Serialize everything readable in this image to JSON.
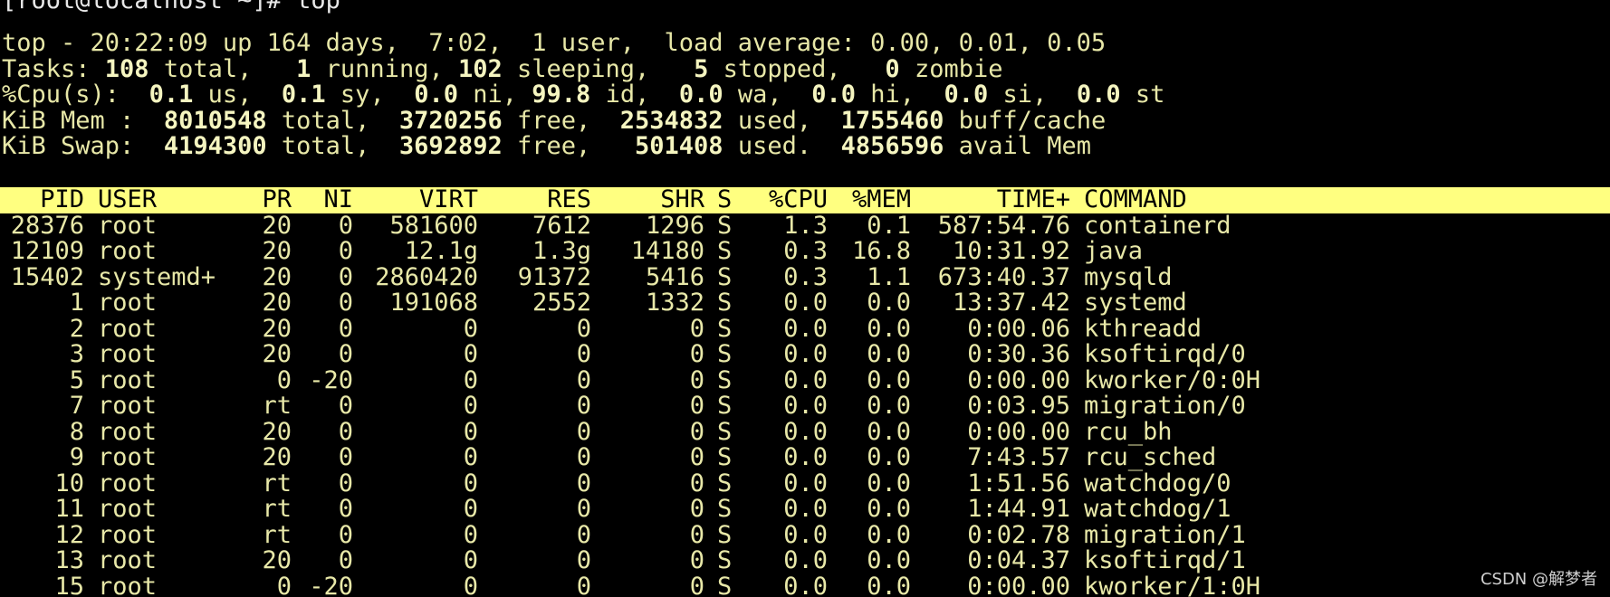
{
  "terminal": {
    "prompt": "[root@localhost ~]# ",
    "command": "top",
    "summary": {
      "top_line": "top - 20:22:09 up 164 days,  7:02,  1 user,  load average: 0.00, 0.01, 0.05",
      "tasks": {
        "label": "Tasks: ",
        "total": "108",
        "total_label": " total,   ",
        "running": "1",
        "running_label": " running, ",
        "sleeping": "102",
        "sleeping_label": " sleeping,   ",
        "stopped": "5",
        "stopped_label": " stopped,   ",
        "zombie": "0",
        "zombie_label": " zombie"
      },
      "cpu": {
        "label": "%Cpu(s):  ",
        "us": "0.1",
        "us_label": " us,  ",
        "sy": "0.1",
        "sy_label": " sy,  ",
        "ni": "0.0",
        "ni_label": " ni, ",
        "id": "99.8",
        "id_label": " id,  ",
        "wa": "0.0",
        "wa_label": " wa,  ",
        "hi": "0.0",
        "hi_label": " hi,  ",
        "si": "0.0",
        "si_label": " si,  ",
        "st": "0.0",
        "st_label": " st"
      },
      "mem": {
        "label": "KiB Mem :  ",
        "total": "8010548",
        "total_label": " total,  ",
        "free": "3720256",
        "free_label": " free,  ",
        "used": "2534832",
        "used_label": " used,  ",
        "cache": "1755460",
        "cache_label": " buff/cache"
      },
      "swap": {
        "label": "KiB Swap:  ",
        "total": "4194300",
        "total_label": " total,  ",
        "free": "3692892",
        "free_label": " free,   ",
        "used": "501408",
        "used_label": " used.  ",
        "avail": "4856596",
        "avail_label": " avail Mem"
      }
    },
    "columns": {
      "pid": "PID",
      "user": "USER",
      "pr": "PR",
      "ni": "NI",
      "virt": "VIRT",
      "res": "RES",
      "shr": "SHR",
      "s": "S",
      "cpu": "%CPU",
      "mem": "%MEM",
      "time": "TIME+",
      "command": "COMMAND"
    },
    "processes": [
      {
        "pid": "28376",
        "user": "root",
        "pr": "20",
        "ni": "0",
        "virt": "581600",
        "res": "7612",
        "shr": "1296",
        "s": "S",
        "cpu": "1.3",
        "mem": "0.1",
        "time": "587:54.76",
        "command": "containerd"
      },
      {
        "pid": "12109",
        "user": "root",
        "pr": "20",
        "ni": "0",
        "virt": "12.1g",
        "res": "1.3g",
        "shr": "14180",
        "s": "S",
        "cpu": "0.3",
        "mem": "16.8",
        "time": "10:31.92",
        "command": "java"
      },
      {
        "pid": "15402",
        "user": "systemd+",
        "pr": "20",
        "ni": "0",
        "virt": "2860420",
        "res": "91372",
        "shr": "5416",
        "s": "S",
        "cpu": "0.3",
        "mem": "1.1",
        "time": "673:40.37",
        "command": "mysqld"
      },
      {
        "pid": "1",
        "user": "root",
        "pr": "20",
        "ni": "0",
        "virt": "191068",
        "res": "2552",
        "shr": "1332",
        "s": "S",
        "cpu": "0.0",
        "mem": "0.0",
        "time": "13:37.42",
        "command": "systemd"
      },
      {
        "pid": "2",
        "user": "root",
        "pr": "20",
        "ni": "0",
        "virt": "0",
        "res": "0",
        "shr": "0",
        "s": "S",
        "cpu": "0.0",
        "mem": "0.0",
        "time": "0:00.06",
        "command": "kthreadd"
      },
      {
        "pid": "3",
        "user": "root",
        "pr": "20",
        "ni": "0",
        "virt": "0",
        "res": "0",
        "shr": "0",
        "s": "S",
        "cpu": "0.0",
        "mem": "0.0",
        "time": "0:30.36",
        "command": "ksoftirqd/0"
      },
      {
        "pid": "5",
        "user": "root",
        "pr": "0",
        "ni": "-20",
        "virt": "0",
        "res": "0",
        "shr": "0",
        "s": "S",
        "cpu": "0.0",
        "mem": "0.0",
        "time": "0:00.00",
        "command": "kworker/0:0H"
      },
      {
        "pid": "7",
        "user": "root",
        "pr": "rt",
        "ni": "0",
        "virt": "0",
        "res": "0",
        "shr": "0",
        "s": "S",
        "cpu": "0.0",
        "mem": "0.0",
        "time": "0:03.95",
        "command": "migration/0"
      },
      {
        "pid": "8",
        "user": "root",
        "pr": "20",
        "ni": "0",
        "virt": "0",
        "res": "0",
        "shr": "0",
        "s": "S",
        "cpu": "0.0",
        "mem": "0.0",
        "time": "0:00.00",
        "command": "rcu_bh"
      },
      {
        "pid": "9",
        "user": "root",
        "pr": "20",
        "ni": "0",
        "virt": "0",
        "res": "0",
        "shr": "0",
        "s": "S",
        "cpu": "0.0",
        "mem": "0.0",
        "time": "7:43.57",
        "command": "rcu_sched"
      },
      {
        "pid": "10",
        "user": "root",
        "pr": "rt",
        "ni": "0",
        "virt": "0",
        "res": "0",
        "shr": "0",
        "s": "S",
        "cpu": "0.0",
        "mem": "0.0",
        "time": "1:51.56",
        "command": "watchdog/0"
      },
      {
        "pid": "11",
        "user": "root",
        "pr": "rt",
        "ni": "0",
        "virt": "0",
        "res": "0",
        "shr": "0",
        "s": "S",
        "cpu": "0.0",
        "mem": "0.0",
        "time": "1:44.91",
        "command": "watchdog/1"
      },
      {
        "pid": "12",
        "user": "root",
        "pr": "rt",
        "ni": "0",
        "virt": "0",
        "res": "0",
        "shr": "0",
        "s": "S",
        "cpu": "0.0",
        "mem": "0.0",
        "time": "0:02.78",
        "command": "migration/1"
      },
      {
        "pid": "13",
        "user": "root",
        "pr": "20",
        "ni": "0",
        "virt": "0",
        "res": "0",
        "shr": "0",
        "s": "S",
        "cpu": "0.0",
        "mem": "0.0",
        "time": "0:04.37",
        "command": "ksoftirqd/1"
      },
      {
        "pid": "15",
        "user": "root",
        "pr": "0",
        "ni": "-20",
        "virt": "0",
        "res": "0",
        "shr": "0",
        "s": "S",
        "cpu": "0.0",
        "mem": "0.0",
        "time": "0:00.00",
        "command": "kworker/1:0H"
      }
    ]
  },
  "watermark": "CSDN @解梦者",
  "colors": {
    "background": "#000000",
    "text": "#e8e8a8",
    "header_bar": "#ffff80"
  }
}
